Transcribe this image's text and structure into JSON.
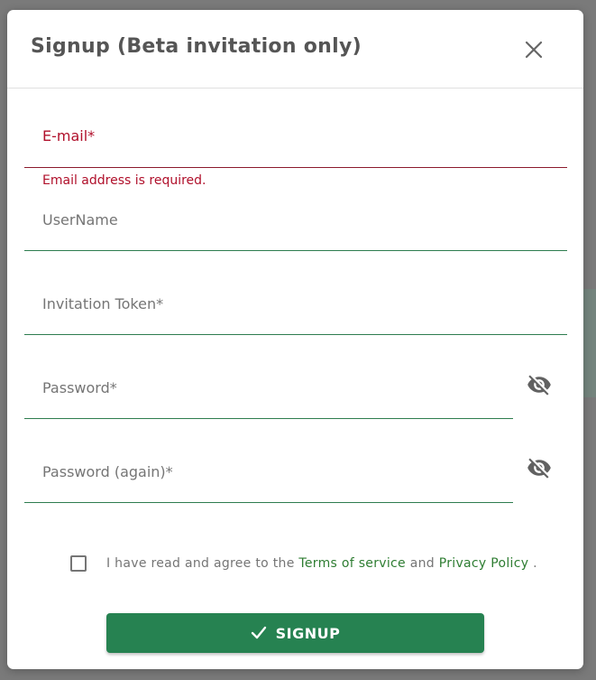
{
  "dialog": {
    "title": "Signup (Beta invitation only)",
    "close_icon": "close-icon"
  },
  "form": {
    "email": {
      "label": "E-mail*",
      "value": "",
      "error": "Email address is required."
    },
    "username": {
      "label": "UserName",
      "value": ""
    },
    "invitation_token": {
      "label": "Invitation Token*",
      "value": ""
    },
    "password": {
      "label": "Password*",
      "value": "",
      "toggle_icon": "eye-off-icon"
    },
    "password_again": {
      "label": "Password (again)*",
      "value": "",
      "toggle_icon": "eye-off-icon"
    }
  },
  "agreement": {
    "checked": false,
    "prefix": "I have read and agree to the ",
    "terms_link": "Terms of service",
    "middle": " and ",
    "privacy_link": "Privacy Policy",
    "suffix": " ."
  },
  "signup_button": {
    "label": "SIGNUP",
    "icon": "check-icon"
  },
  "colors": {
    "primary": "#268251",
    "error": "#b0102b",
    "link": "#2e7d32",
    "underline": "#2e7d4f"
  }
}
